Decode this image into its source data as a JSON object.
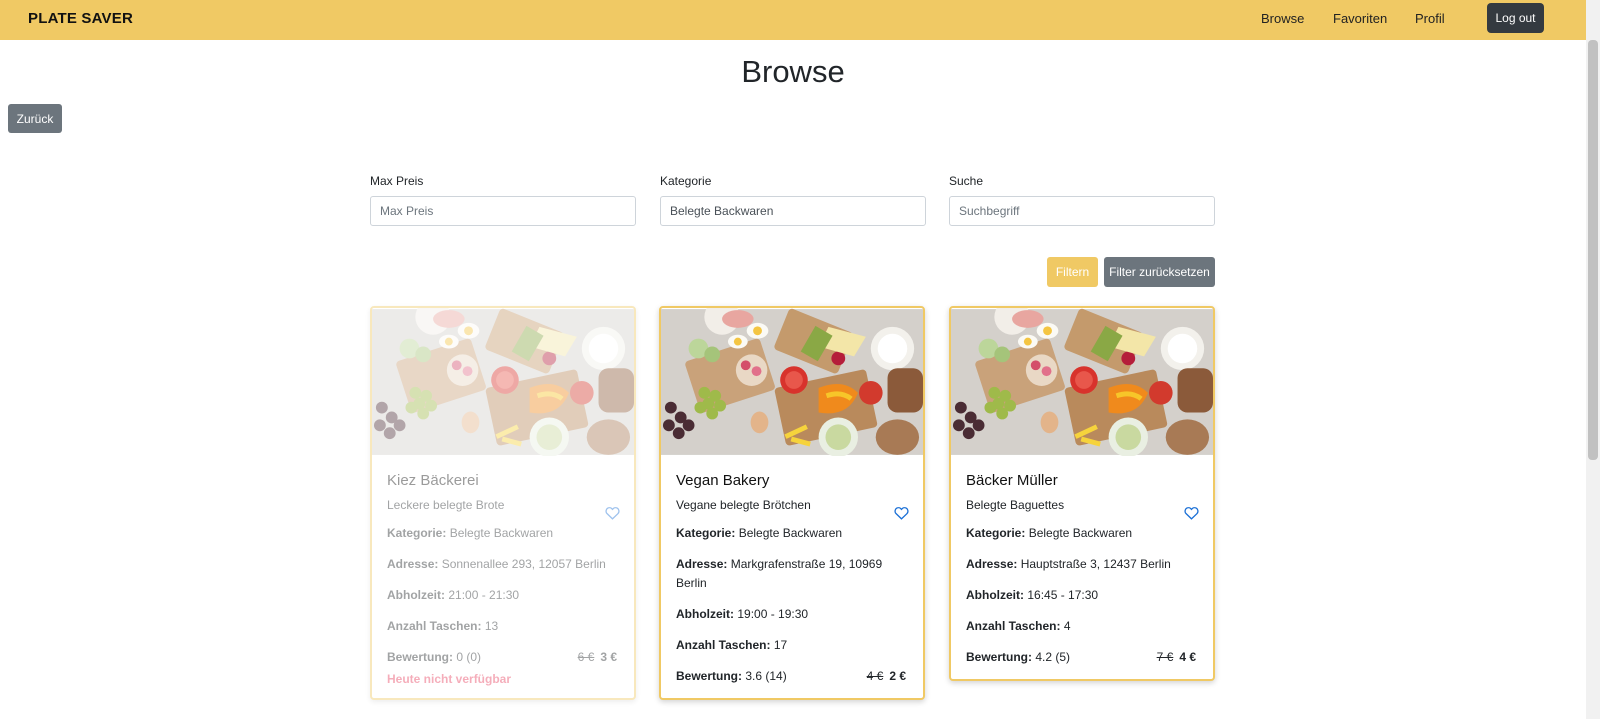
{
  "navbar": {
    "brand": "PLATE SAVER",
    "links": [
      "Browse",
      "Favoriten",
      "Profil"
    ],
    "logout": "Log out",
    "color": "#f0c964"
  },
  "page": {
    "title": "Browse",
    "back": "Zurück"
  },
  "filters": {
    "max_price": {
      "label": "Max Preis",
      "placeholder": "Max Preis",
      "value": ""
    },
    "category": {
      "label": "Kategorie",
      "value": "Belegte Backwaren"
    },
    "search": {
      "label": "Suche",
      "placeholder": "Suchbegriff",
      "value": ""
    },
    "filter_button": "Filtern",
    "reset_button": "Filter zurücksetzen"
  },
  "card_labels": {
    "category": "Kategorie:",
    "address": "Adresse:",
    "pickup": "Abholzeit:",
    "bags": "Anzahl Taschen:",
    "rating": "Bewertung:"
  },
  "cards": [
    {
      "title": "Kiez Bäckerei",
      "subtitle": "Leckere belegte Brote",
      "category": "Belegte Backwaren",
      "address": "Sonnenallee 293, 12057 Berlin",
      "pickup": "21:00 - 21:30",
      "bags": "13",
      "rating": "0 (0)",
      "price_old": "6 €",
      "price_new": "3 €",
      "status": "Heute nicht verfügbar",
      "icon": "heart-outline-icon"
    },
    {
      "title": "Vegan Bakery",
      "subtitle": "Vegane belegte Brötchen",
      "category": "Belegte Backwaren",
      "address": "Markgrafenstraße 19, 10969 Berlin",
      "pickup": "19:00 - 19:30",
      "bags": "17",
      "rating": "3.6 (14)",
      "price_old": "4 €",
      "price_new": "2 €",
      "icon": "heart-outline-icon"
    },
    {
      "title": "Bäcker Müller",
      "subtitle": "Belegte Baguettes",
      "category": "Belegte Backwaren",
      "address": "Hauptstraße 3, 12437 Berlin",
      "pickup": "16:45 - 17:30",
      "bags": "4",
      "rating": "4.2 (5)",
      "price_old": "7 €",
      "price_new": "4 €",
      "icon": "heart-outline-icon"
    }
  ]
}
